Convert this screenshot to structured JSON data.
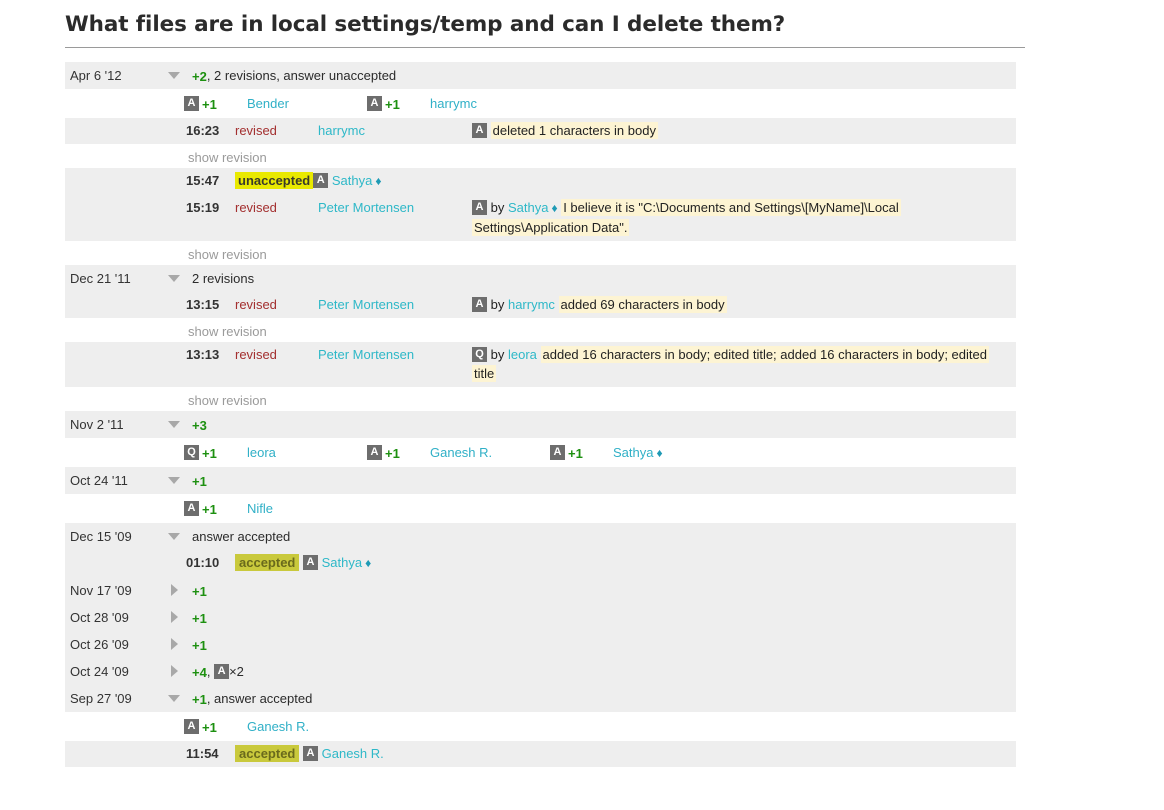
{
  "page": {
    "title": "What files are in local settings/temp and can I delete them?"
  },
  "colors": {
    "accent_user": "#2eb8c8",
    "vote_green": "#1d9010",
    "revised_red": "#a32f2f",
    "badge_gray": "#6d6d6d",
    "row_shade": "#eeeeee",
    "highlight_comment": "#fdf4d3",
    "highlight_unaccepted": "#e9e900",
    "highlight_accepted": "#c9c93c"
  },
  "labels": {
    "show_revision": "show revision",
    "by": "by",
    "revised": "revised",
    "accepted": "accepted",
    "unaccepted": "unaccepted",
    "diamond": "♦",
    "times": "×2"
  },
  "groups": [
    {
      "date": "Apr 6 '12",
      "expanded": true,
      "summary_vote": "+2",
      "summary_rest": ", 2 revisions, answer unaccepted",
      "votes": [
        {
          "badge": "A",
          "vote": "+1",
          "user": "Bender"
        },
        {
          "badge": "A",
          "vote": "+1",
          "user": "harrymc"
        }
      ],
      "events": [
        {
          "time": "16:23",
          "action": "revised",
          "user": "harrymc",
          "detail_badge": "A",
          "detail_text": "deleted 1 characters in body",
          "show_revision": true
        },
        {
          "time": "15:47",
          "status": "unaccepted",
          "status_badge": "A",
          "status_user": "Sathya",
          "status_diamond": true
        },
        {
          "time": "15:19",
          "action": "revised",
          "user": "Peter Mortensen",
          "detail_badge": "A",
          "detail_by_user": "Sathya",
          "detail_by_diamond": true,
          "detail_text": "I believe it is \"C:\\Documents and Settings\\[MyName]\\Local Settings\\Application Data\".",
          "show_revision": true
        }
      ]
    },
    {
      "date": "Dec 21 '11",
      "expanded": true,
      "summary_vote": "",
      "summary_rest": "2 revisions",
      "votes": [],
      "events": [
        {
          "time": "13:15",
          "action": "revised",
          "user": "Peter Mortensen",
          "detail_badge": "A",
          "detail_by_user": "harrymc",
          "detail_text": "added 69 characters in body",
          "show_revision": true
        },
        {
          "time": "13:13",
          "action": "revised",
          "user": "Peter Mortensen",
          "detail_badge": "Q",
          "detail_by_user": "leora",
          "detail_text": "added 16 characters in body; edited title; added 16 characters in body; edited title",
          "show_revision": true
        }
      ]
    },
    {
      "date": "Nov 2 '11",
      "expanded": true,
      "summary_vote": "+3",
      "summary_rest": "",
      "votes": [
        {
          "badge": "Q",
          "vote": "+1",
          "user": "leora"
        },
        {
          "badge": "A",
          "vote": "+1",
          "user": "Ganesh R."
        },
        {
          "badge": "A",
          "vote": "+1",
          "user": "Sathya",
          "diamond": true
        }
      ],
      "events": []
    },
    {
      "date": "Oct 24 '11",
      "expanded": true,
      "summary_vote": "+1",
      "summary_rest": "",
      "votes": [
        {
          "badge": "A",
          "vote": "+1",
          "user": "Nifle"
        }
      ],
      "events": []
    },
    {
      "date": "Dec 15 '09",
      "expanded": true,
      "summary_vote": "",
      "summary_rest": "answer accepted",
      "votes": [],
      "events": [
        {
          "time": "01:10",
          "status": "accepted",
          "status_badge": "A",
          "status_user": "Sathya",
          "status_diamond": true
        }
      ]
    },
    {
      "date": "Nov 17 '09",
      "expanded": false,
      "summary_vote": "+1",
      "summary_rest": "",
      "votes": [],
      "events": []
    },
    {
      "date": "Oct 28 '09",
      "expanded": false,
      "summary_vote": "+1",
      "summary_rest": "",
      "votes": [],
      "events": []
    },
    {
      "date": "Oct 26 '09",
      "expanded": false,
      "summary_vote": "+1",
      "summary_rest": "",
      "votes": [],
      "events": []
    },
    {
      "date": "Oct 24 '09",
      "expanded": false,
      "summary_vote": "+4",
      "summary_rest": ", ",
      "summary_badge": "A",
      "summary_badge_suffix": "×2",
      "votes": [],
      "events": []
    },
    {
      "date": "Sep 27 '09",
      "expanded": true,
      "summary_vote": "+1",
      "summary_rest": ", answer accepted",
      "votes": [
        {
          "badge": "A",
          "vote": "+1",
          "user": "Ganesh R."
        }
      ],
      "events": [
        {
          "time": "11:54",
          "status": "accepted",
          "status_badge": "A",
          "status_user": "Ganesh R."
        }
      ]
    }
  ]
}
